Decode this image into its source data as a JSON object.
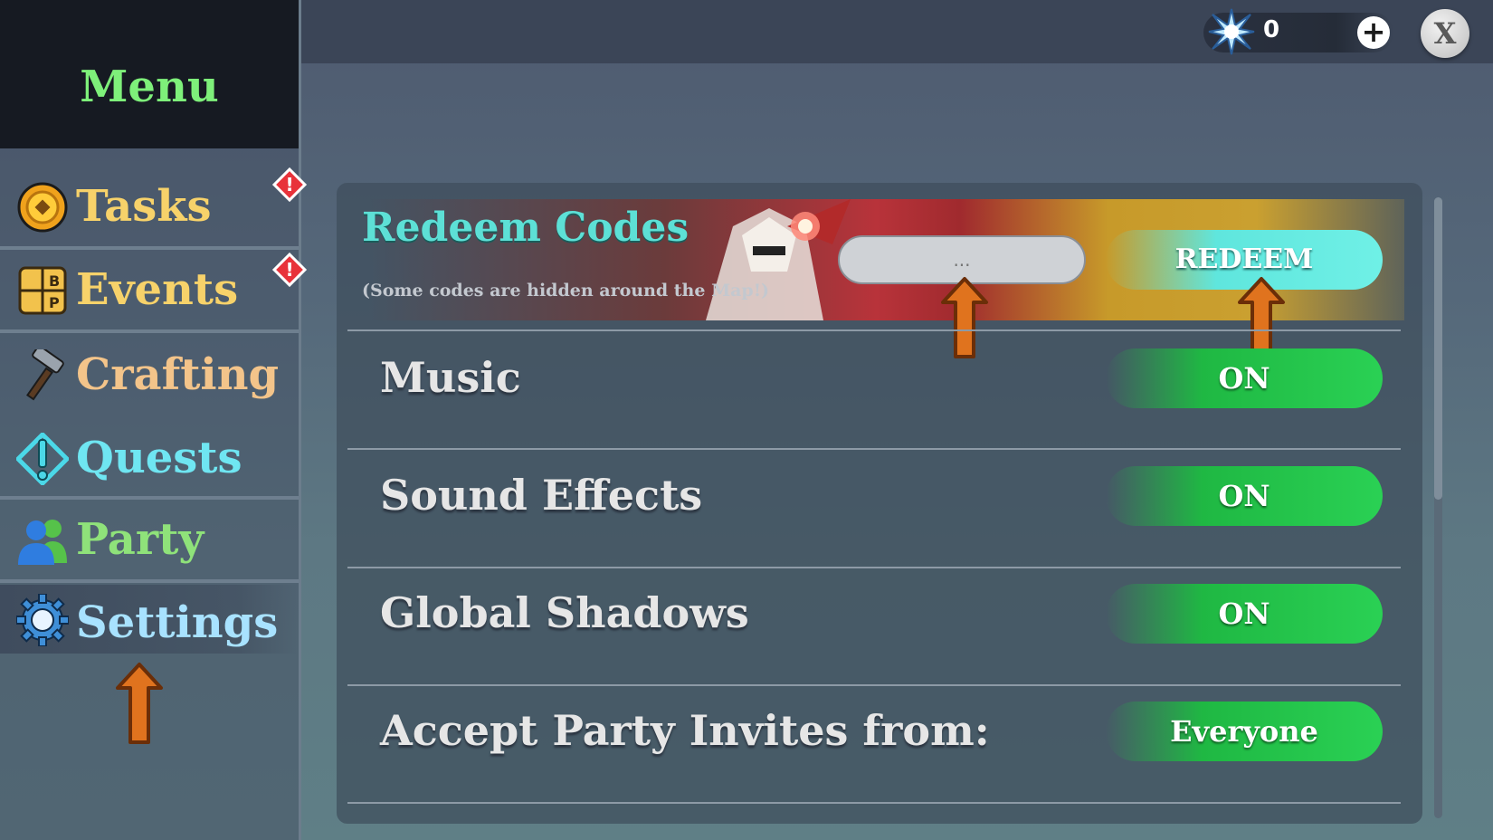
{
  "topbar": {
    "currency_value": "0",
    "plus_label": "+",
    "close_label": "X"
  },
  "sidebar": {
    "title": "Menu",
    "items": [
      {
        "label": "Tasks",
        "color": "#f7d26a",
        "icon": "coin-icon",
        "alert": true
      },
      {
        "label": "Events",
        "color": "#f7d26a",
        "icon": "events-card-icon",
        "alert": true
      },
      {
        "label": "Crafting",
        "color": "#f3c48a",
        "icon": "hammer-icon",
        "alert": false
      },
      {
        "label": "Quests",
        "color": "#6fe6f2",
        "icon": "quest-exclamation-icon",
        "alert": false
      },
      {
        "label": "Party",
        "color": "#8fe27a",
        "icon": "party-people-icon",
        "alert": false
      },
      {
        "label": "Settings",
        "color": "#a8e2ff",
        "icon": "gear-icon",
        "alert": false,
        "active": true
      }
    ],
    "alert_label": "!"
  },
  "redeem": {
    "title": "Redeem Codes",
    "subtitle": "(Some codes are hidden around the Map!)",
    "input_placeholder": "...",
    "button_label": "REDEEM"
  },
  "settings": [
    {
      "label": "Music",
      "value": "ON"
    },
    {
      "label": "Sound Effects",
      "value": "ON"
    },
    {
      "label": "Global Shadows",
      "value": "ON"
    },
    {
      "label": "Accept Party Invites from:",
      "value": "Everyone"
    }
  ],
  "colors": {
    "menu_title": "#7ef07a",
    "redeem_title": "#5de0d6",
    "toggle_on": "#2ad154",
    "arrow": "#e0731e"
  }
}
